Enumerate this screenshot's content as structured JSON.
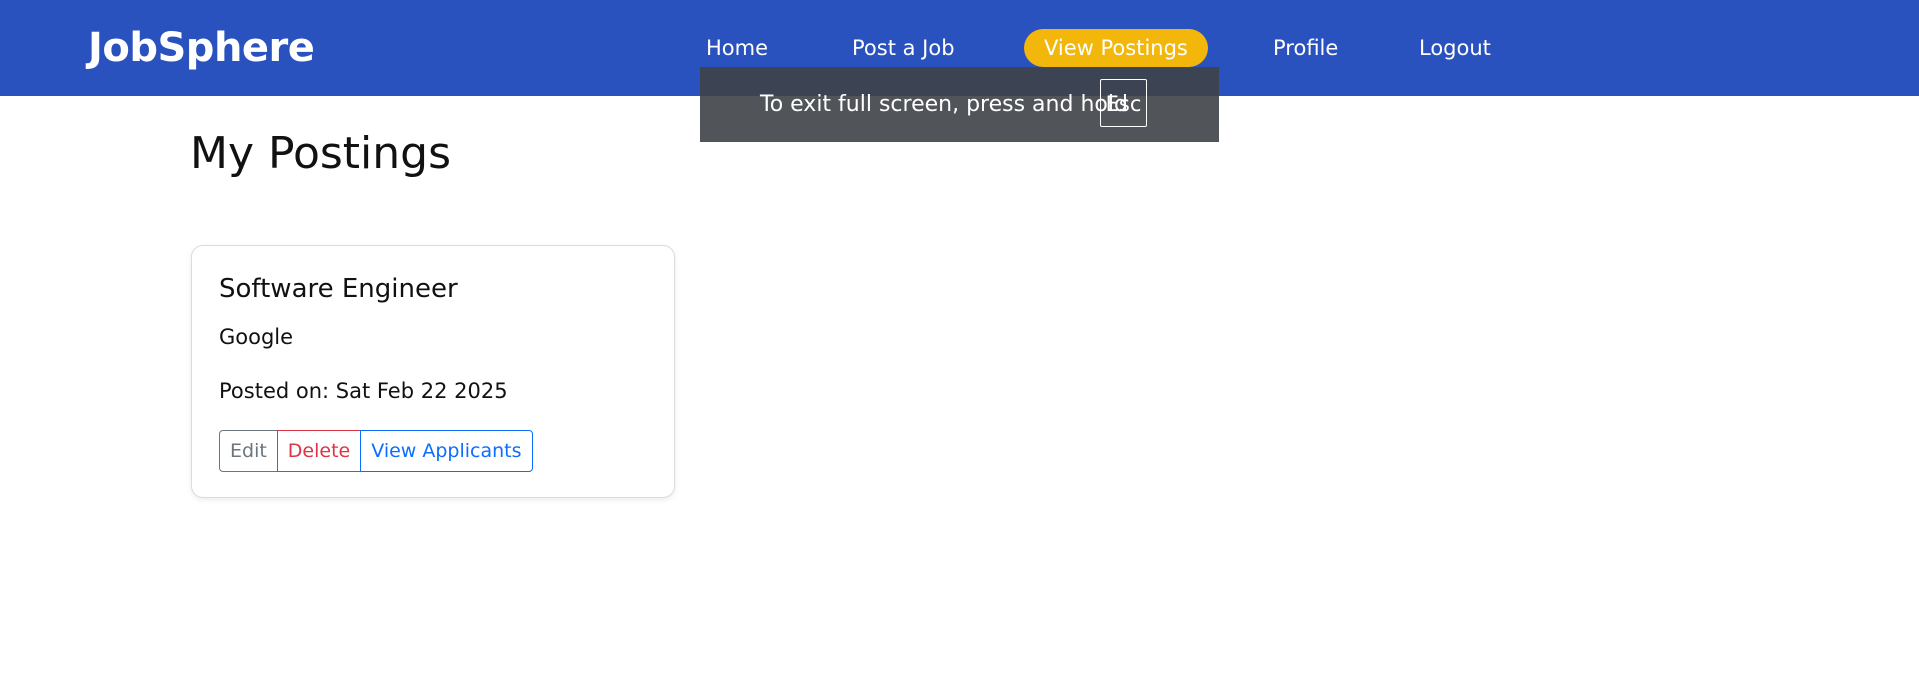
{
  "navbar": {
    "brand": "JobSphere",
    "items": [
      {
        "label": "Home"
      },
      {
        "label": "Post a Job"
      },
      {
        "label": "View Postings",
        "active": true
      },
      {
        "label": "Profile"
      },
      {
        "label": "Logout"
      }
    ],
    "background_color": "#2a52be",
    "active_color": "#f2b70a"
  },
  "fullscreen_notice": {
    "text": "To exit full screen, press and hold",
    "key": "Esc"
  },
  "main": {
    "title": "My Postings",
    "postings": [
      {
        "title": "Software Engineer",
        "company": "Google",
        "posted_on": "Posted on: Sat Feb 22 2025",
        "actions": {
          "edit": "Edit",
          "delete": "Delete",
          "view_applicants": "View Applicants"
        }
      }
    ]
  }
}
